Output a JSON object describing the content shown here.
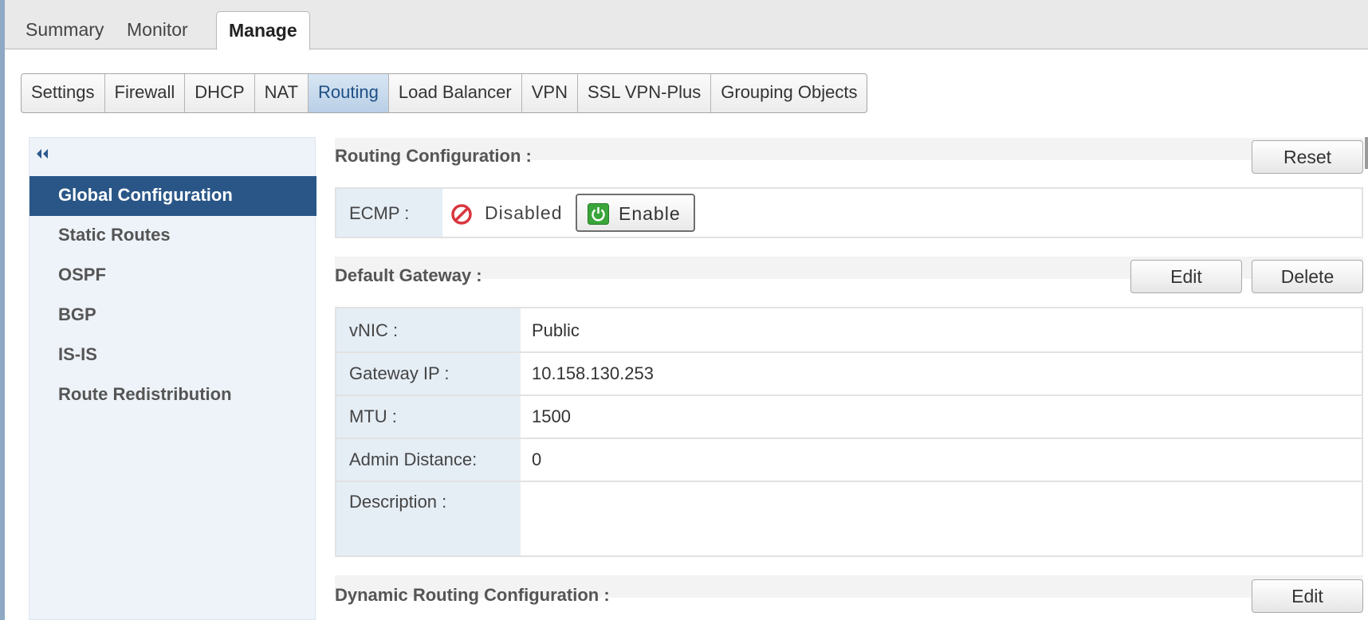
{
  "top_tabs": [
    "Summary",
    "Monitor",
    "Manage"
  ],
  "sub_tabs": [
    "Settings",
    "Firewall",
    "DHCP",
    "NAT",
    "Routing",
    "Load Balancer",
    "VPN",
    "SSL VPN-Plus",
    "Grouping Objects"
  ],
  "left_nav": {
    "collapse_icon": "double-chevron-left-icon",
    "items": [
      "Global Configuration",
      "Static Routes",
      "OSPF",
      "BGP",
      "IS-IS",
      "Route Redistribution"
    ]
  },
  "routing_config": {
    "title": "Routing Configuration :",
    "reset_label": "Reset",
    "ecmp_label": "ECMP :",
    "ecmp_status": "Disabled",
    "enable_label": "Enable"
  },
  "default_gateway": {
    "title": "Default Gateway :",
    "edit_label": "Edit",
    "delete_label": "Delete",
    "rows": [
      {
        "label": "vNIC :",
        "value": "Public"
      },
      {
        "label": "Gateway IP :",
        "value": "10.158.130.253"
      },
      {
        "label": "MTU :",
        "value": "1500"
      },
      {
        "label": "Admin Distance:",
        "value": "0"
      },
      {
        "label": "Description :",
        "value": ""
      }
    ]
  },
  "dynamic_routing": {
    "title": "Dynamic Routing Configuration :",
    "edit_label": "Edit"
  },
  "colors": {
    "accent": "#2a5687",
    "selected_tab": "#c9dcef",
    "label_cell_bg": "#e5edf5",
    "disabled_red": "#d9363e",
    "enable_green": "#3aa53a"
  }
}
